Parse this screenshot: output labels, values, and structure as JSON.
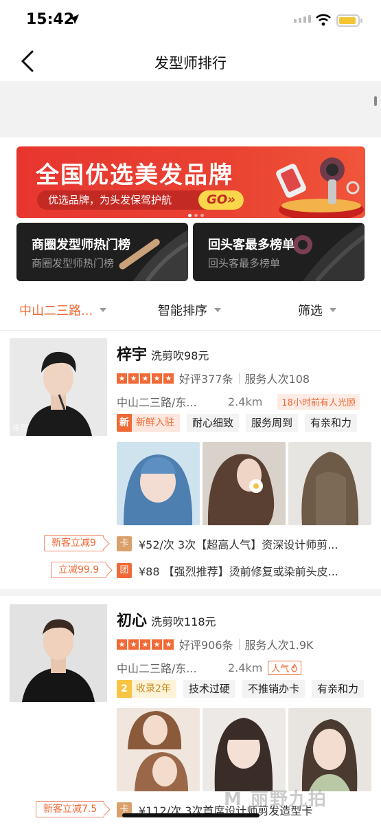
{
  "status_bar": {
    "time": "15:42"
  },
  "nav": {
    "title": "发型师排行"
  },
  "banner": {
    "title": "全国优选美发品牌",
    "subtitle": "优选品牌，为头发保驾护航",
    "go": "GO»"
  },
  "rank_cards": [
    {
      "title": "商圈发型师热门榜",
      "subtitle": "商圈发型师热门榜"
    },
    {
      "title": "回头客最多榜单",
      "subtitle": "回头客最多榜单"
    }
  ],
  "filters": {
    "location": "中山二三路...",
    "sort": "智能排序",
    "screen": "筛选"
  },
  "stylists": [
    {
      "name": "梓宇",
      "price": "洗剪吹98元",
      "rating": "好评377条",
      "served": "服务人次108",
      "address": "中山二三路/东...",
      "distance": "2.4km",
      "extra": "18小时前有人光顾",
      "badge_key": "新",
      "badge_value": "新鲜入驻",
      "tags": [
        "耐心细致",
        "服务周到",
        "有亲和力"
      ],
      "avatar_watermark": "推荐",
      "deals": [
        {
          "coupon": "新客立减9",
          "icon": "卡",
          "icon_color": "#d9a06b",
          "text": "¥52/次 3次【超高人气】资深设计师剪..."
        },
        {
          "coupon": "立减99.9",
          "icon": "团",
          "icon_color": "#ef6a36",
          "text": "¥88 【强烈推荐】烫前修复或染前头皮..."
        }
      ]
    },
    {
      "name": "初心",
      "price": "洗剪吹118元",
      "rating": "好评906条",
      "served": "服务人次1.9K",
      "address": "中山二三路/东...",
      "distance": "2.4km",
      "extra": "人气",
      "badge_key": "2",
      "badge_value": "收录2年",
      "tags": [
        "技术过硬",
        "不推销办卡",
        "有亲和力"
      ],
      "deals": [
        {
          "coupon": "新客立减7.5",
          "icon": "卡",
          "icon_color": "#d9a06b",
          "text": "¥112/次 3次首席设计师剪发造型卡"
        }
      ]
    }
  ],
  "watermark": "M 丽野九拍",
  "colors": {
    "accent": "#ef6a36",
    "banner_red": "#e8362f",
    "gold": "#f7c443"
  }
}
